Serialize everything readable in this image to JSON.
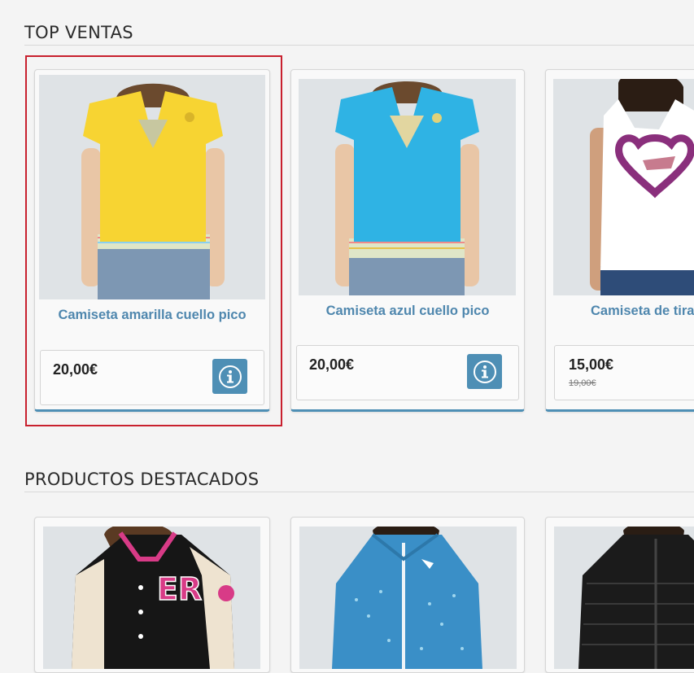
{
  "sections": {
    "top": {
      "title": "TOP VENTAS"
    },
    "featured": {
      "title": "PRODUCTOS DESTACADOS"
    }
  },
  "top_products": [
    {
      "name": "Camiseta amarilla cuello pico",
      "price": "20,00€",
      "color": "#f7d432"
    },
    {
      "name": "Camiseta azul cuello pico",
      "price": "20,00€",
      "color": "#2fb3e4"
    },
    {
      "name": "Camiseta de tirantes",
      "price": "15,00€",
      "old_price": "19,00€",
      "color": "#ffffff"
    }
  ],
  "featured_products": [
    {
      "image": "black varsity jacket with pink ER letters"
    },
    {
      "image": "blue dotted jacket"
    },
    {
      "image": "black quilted jacket"
    }
  ],
  "colors": {
    "accent": "#4e8fb5",
    "link": "#4f87ae",
    "highlight": "#c8202e"
  }
}
